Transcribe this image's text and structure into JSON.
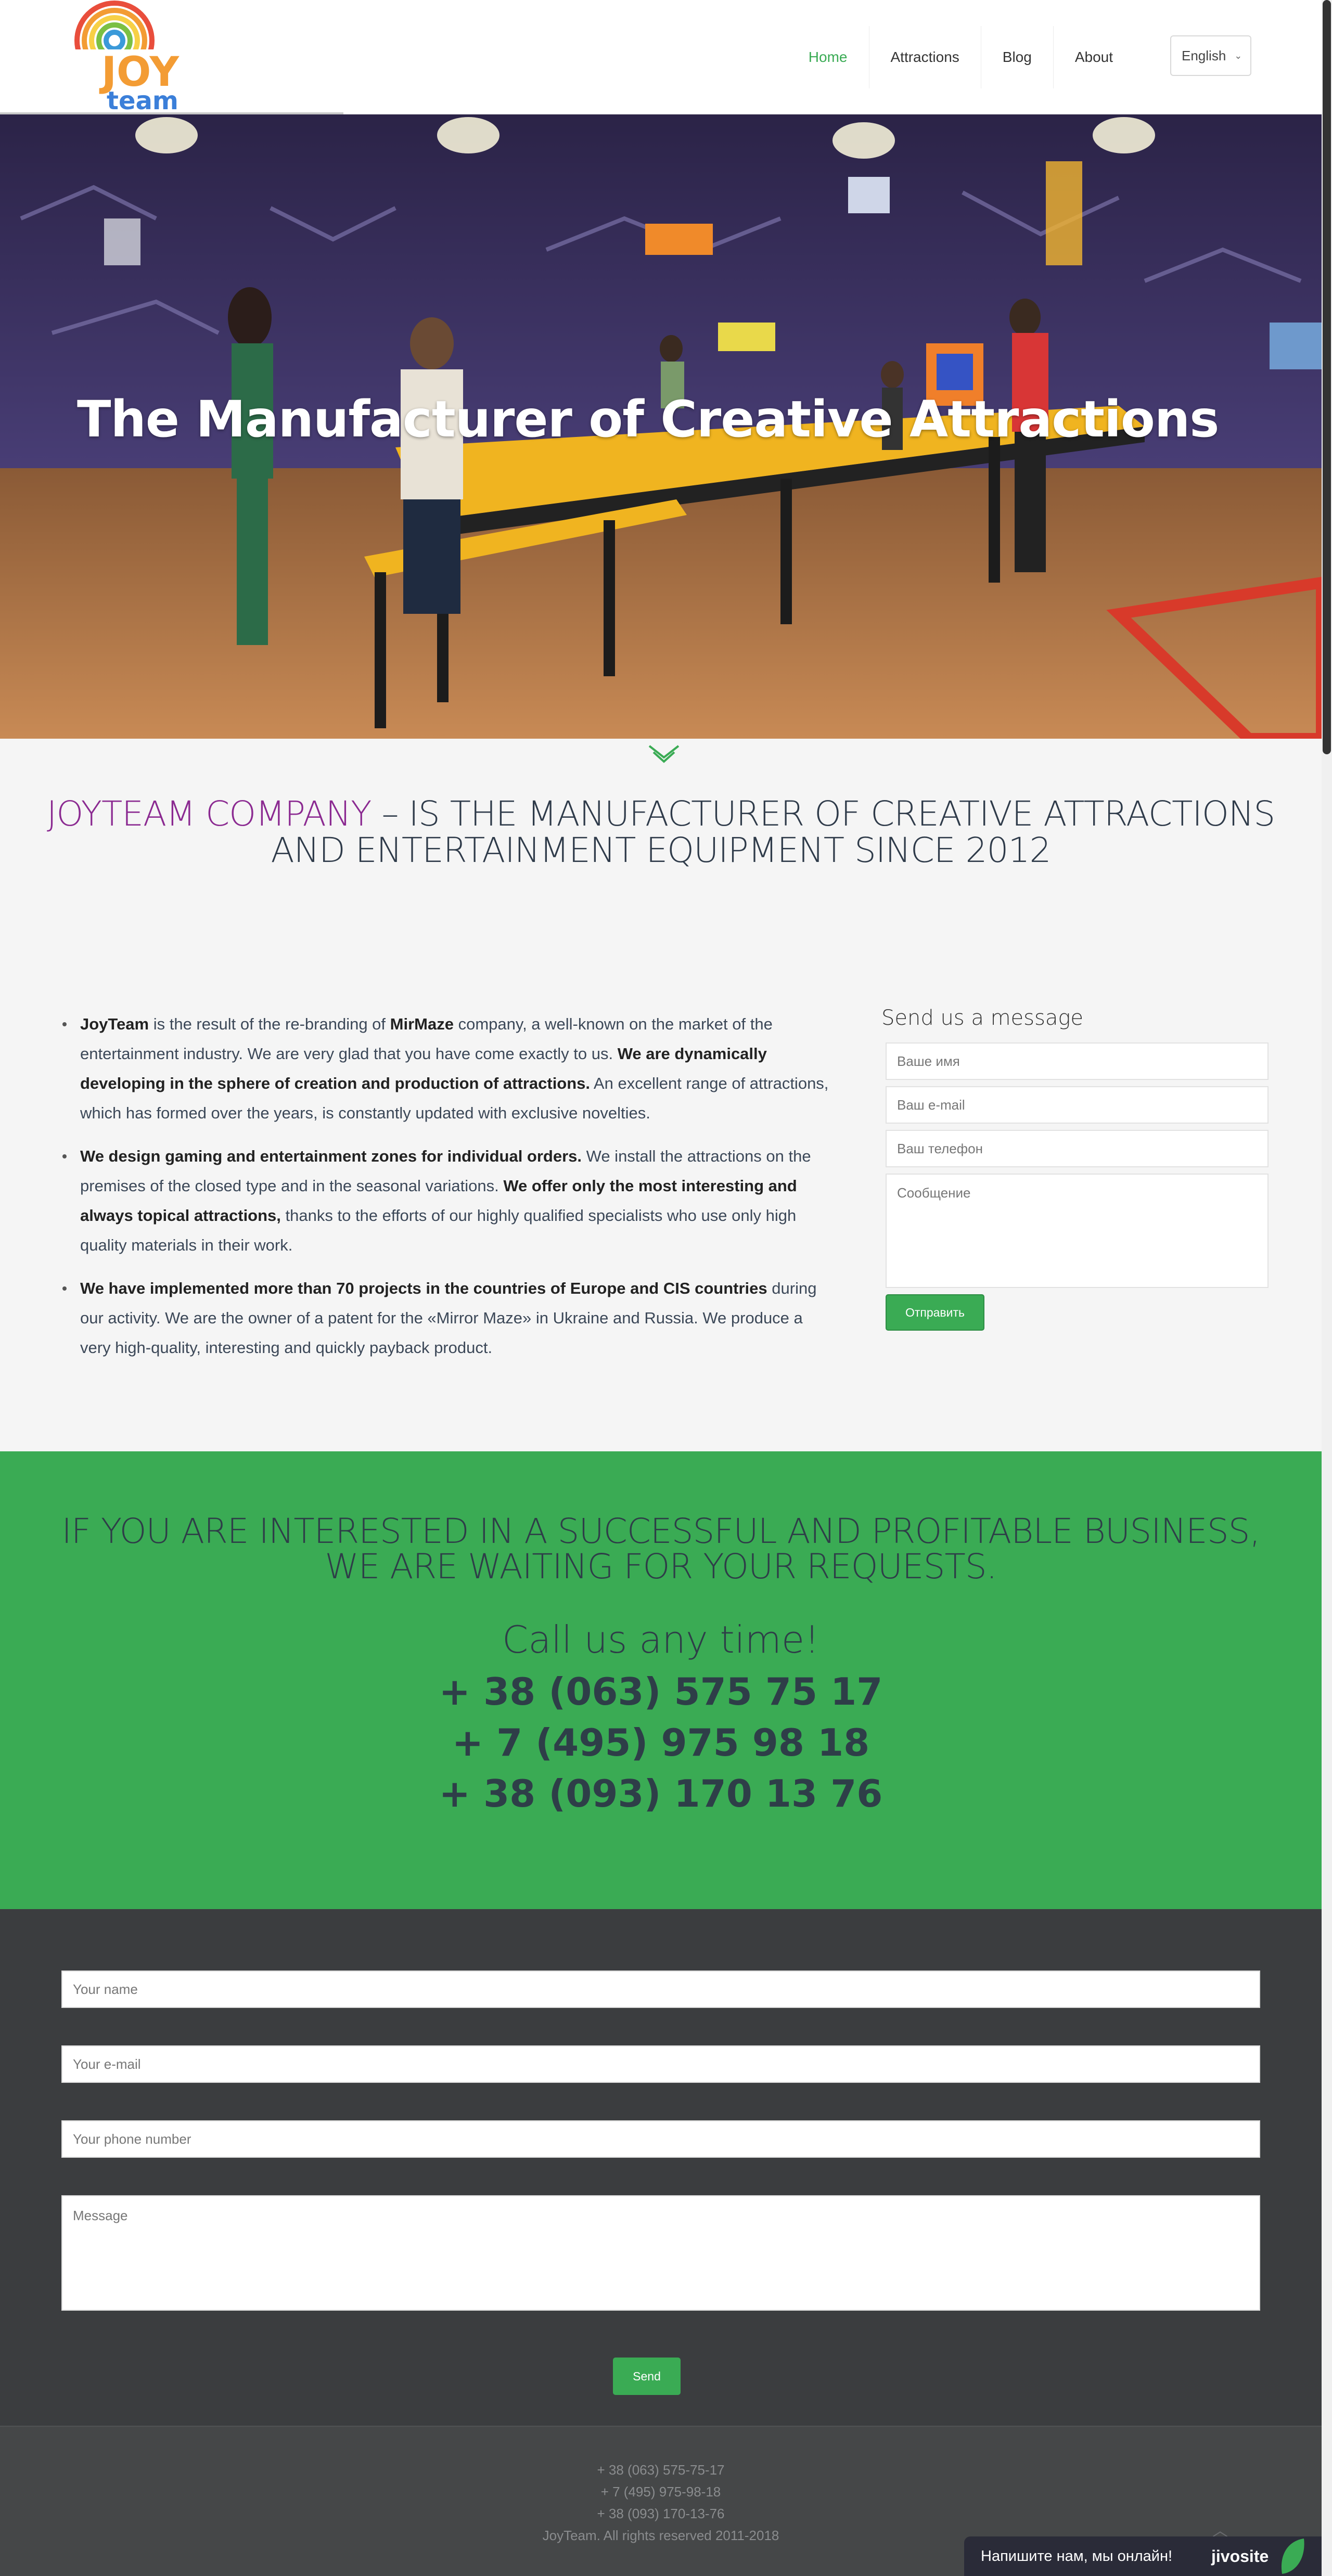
{
  "header": {
    "nav": [
      "Home",
      "Attractions",
      "Blog",
      "About"
    ],
    "active_nav": "Home",
    "language": "English"
  },
  "logo": {
    "line1": "JOY",
    "line2": "team"
  },
  "hero": {
    "title": "The Manufacturer of Creative Attractions"
  },
  "intro": {
    "accent": "JOYTEAM COMPANY",
    "rest_line1": " – IS THE MANUFACTURER OF CREATIVE ATTRACTIONS",
    "line2": "AND ENTERTAINMENT EQUIPMENT SINCE 2012"
  },
  "about": {
    "p1_b1": "JoyTeam",
    "p1_t1": " is the result of the re-branding of ",
    "p1_b2": "MirMaze",
    "p1_t2": " company, a well-known on the market of the entertainment industry. We are very glad that you have come exactly to us. ",
    "p1_b3": "We are dynamically developing in the sphere of creation and production of attractions.",
    "p1_t3": " An excellent range of attractions, which has formed over the years, is constantly updated with exclusive novelties.",
    "p2_b1": "We design gaming and entertainment zones for individual orders.",
    "p2_t1": " We install the attractions on the premises of the closed type and in the seasonal variations. ",
    "p2_b2": "We offer only the most interesting and always topical attractions,",
    "p2_t2": " thanks to the efforts of our highly qualified specialists who use only high quality materials in their work.",
    "p3_b1": "We have implemented more than 70 projects in the countries of Europe and CIS countries",
    "p3_t1": " during our activity. We are the owner of a patent for the «Mirror Maze» in Ukraine and Russia. We produce a very high-quality, interesting and quickly payback product."
  },
  "side_form": {
    "title": "Send us a message",
    "name_placeholder": "Ваше имя",
    "email_placeholder": "Ваш e-mail",
    "phone_placeholder": "Ваш телефон",
    "message_placeholder": "Сообщение",
    "submit": "Отправить"
  },
  "cta": {
    "line1": "IF YOU ARE INTERESTED IN A SUCCESSFUL AND PROFITABLE BUSINESS,",
    "line2": "WE ARE WAITING FOR YOUR REQUESTS.",
    "call": "Call us any time!",
    "phones": [
      "+ 38 (063) 575 75 17",
      "+ 7 (495) 975 98 18",
      "+ 38 (093) 170 13 76"
    ]
  },
  "bottom_form": {
    "name_placeholder": "Your name",
    "email_placeholder": "Your e-mail",
    "phone_placeholder": "Your phone number",
    "message_placeholder": "Message",
    "submit": "Send"
  },
  "footer": {
    "phones": [
      "+ 38 (063) 575-75-17",
      "+ 7 (495) 975-98-18",
      "+ 38 (093) 170-13-76"
    ],
    "copyright": "JoyTeam. All rights reserved 2011-2018"
  },
  "chat": {
    "text": "Напишите нам, мы онлайн!",
    "brand": "jivosite"
  },
  "colors": {
    "accent_green": "#3aab54",
    "accent_purple": "#8b2a91",
    "dark_bg": "#3b3d3f"
  }
}
